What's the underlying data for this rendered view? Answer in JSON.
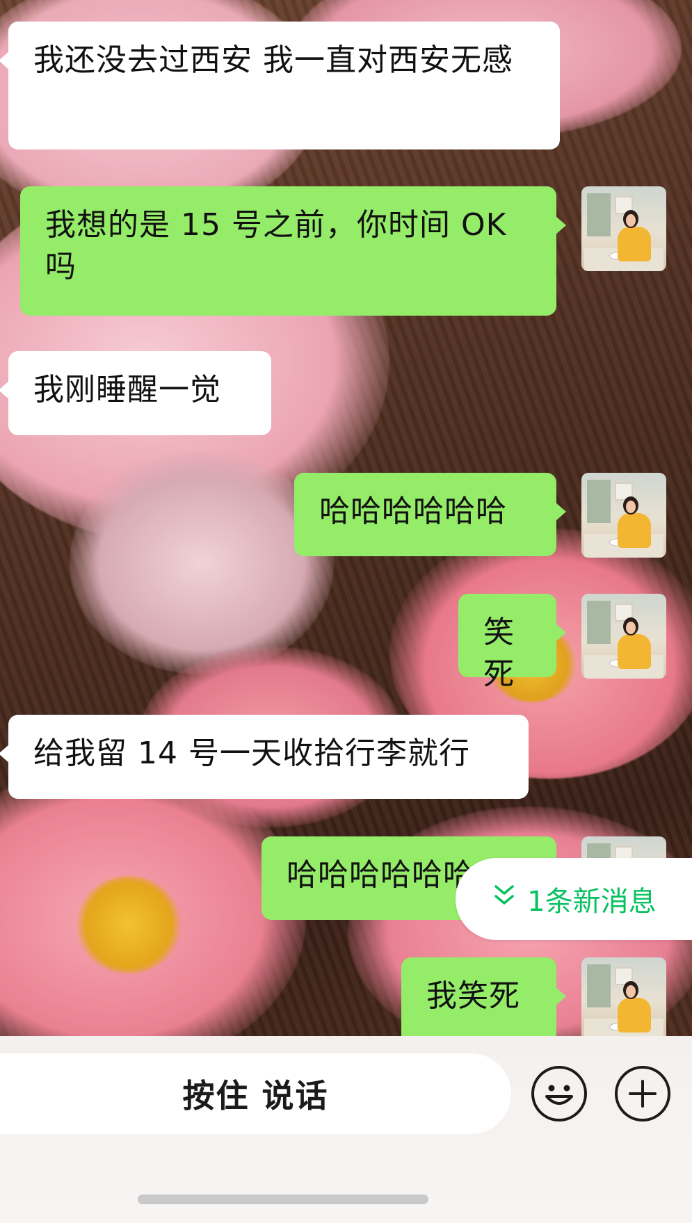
{
  "messages": [
    {
      "side": "left",
      "text": "我还没去过西安 我一直对西安无感"
    },
    {
      "side": "right",
      "text": "我想的是 15 号之前，你时间 OK 吗"
    },
    {
      "side": "left",
      "text": "我刚睡醒一觉"
    },
    {
      "side": "right",
      "text": "哈哈哈哈哈哈"
    },
    {
      "side": "right",
      "text": "笑死"
    },
    {
      "side": "left",
      "text": "给我留 14 号一天收拾行李就行"
    },
    {
      "side": "right",
      "text": "哈哈哈哈哈哈"
    },
    {
      "side": "right",
      "text": "我笑死"
    }
  ],
  "new_message_pill": {
    "label": "1条新消息",
    "icon": "double-chevron-down-icon",
    "color": "#07c160"
  },
  "input_bar": {
    "voice_label": "按住 说话",
    "emoji_icon": "smiley-icon",
    "plus_icon": "plus-icon"
  },
  "colors": {
    "bubble_self": "#95ec69",
    "bubble_other": "#ffffff"
  }
}
